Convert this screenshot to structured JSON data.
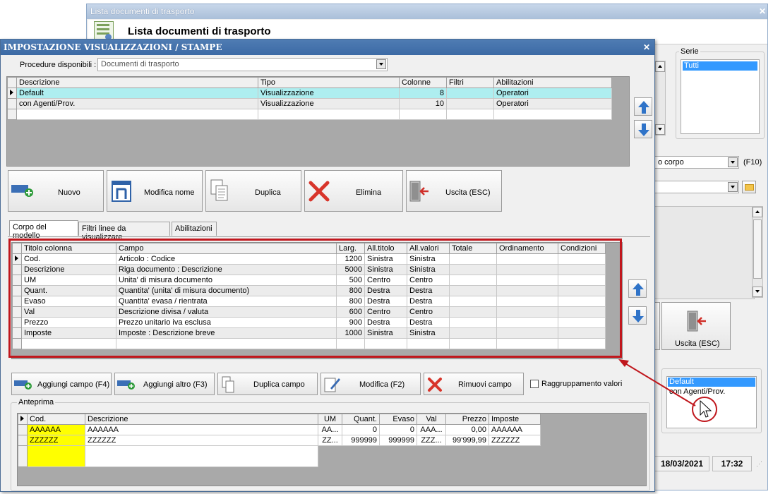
{
  "back_window": {
    "title": "Lista documenti di trasporto",
    "header_title": "Lista documenti di trasporto",
    "serie_label": "Serie",
    "serie_items": [
      "Tutti"
    ],
    "combo_right_value": "o corpo",
    "combo_right_shortcut": "(F10)",
    "uscita_label": "Uscita (ESC)",
    "profile_list": [
      "Default",
      "con Agenti/Prov."
    ],
    "status_date": "18/03/2021",
    "status_time": "17:32"
  },
  "front_window": {
    "title": "IMPOSTAZIONE VISUALIZZAZIONI / STAMPE",
    "procedure_label": "Procedure disponibili :",
    "procedure_value": "Documenti di trasporto",
    "views_grid": {
      "headers": [
        "Descrizione",
        "Tipo",
        "Colonne",
        "Filtri",
        "Abilitazioni"
      ],
      "rows": [
        [
          "Default",
          "Visualizzazione",
          "8",
          "",
          "Operatori"
        ],
        [
          "con Agenti/Prov.",
          "Visualizzazione",
          "10",
          "",
          "Operatori"
        ]
      ]
    },
    "buttons": {
      "nuovo": "Nuovo",
      "modifica_nome": "Modifica nome",
      "duplica": "Duplica",
      "elimina": "Elimina",
      "uscita": "Uscita (ESC)"
    },
    "tabs": [
      "Corpo del modello",
      "Filtri linee da visualizzare",
      "Abilitazioni"
    ],
    "columns_grid": {
      "headers": [
        "Titolo colonna",
        "Campo",
        "Larg.",
        "All.titolo",
        "All.valori",
        "Totale",
        "Ordinamento",
        "Condizioni"
      ],
      "rows": [
        [
          "Cod.",
          "Articolo : Codice",
          "1200",
          "Sinistra",
          "Sinistra",
          "",
          "",
          ""
        ],
        [
          "Descrizione",
          "Riga documento : Descrizione",
          "5000",
          "Sinistra",
          "Sinistra",
          "",
          "",
          ""
        ],
        [
          "UM",
          "Unita' di misura documento",
          "500",
          "Centro",
          "Centro",
          "",
          "",
          ""
        ],
        [
          "Quant.",
          "Quantita' (unita' di misura documento)",
          "800",
          "Destra",
          "Destra",
          "",
          "",
          ""
        ],
        [
          "Evaso",
          "Quantita' evasa / rientrata",
          "800",
          "Destra",
          "Destra",
          "",
          "",
          ""
        ],
        [
          "Val",
          "Descrizione divisa / valuta",
          "600",
          "Centro",
          "Centro",
          "",
          "",
          ""
        ],
        [
          "Prezzo",
          "Prezzo unitario iva esclusa",
          "900",
          "Destra",
          "Destra",
          "",
          "",
          ""
        ],
        [
          "Imposte",
          "Imposte : Descrizione breve",
          "1000",
          "Sinistra",
          "Sinistra",
          "",
          "",
          ""
        ]
      ]
    },
    "field_buttons": {
      "aggiungi_campo": "Aggiungi campo (F4)",
      "aggiungi_altro": "Aggiungi altro (F3)",
      "duplica_campo": "Duplica campo",
      "modifica": "Modifica (F2)",
      "rimuovi_campo": "Rimuovi campo"
    },
    "raggruppamento_label": "Raggruppamento valori",
    "anteprima": {
      "label": "Anteprima",
      "headers": [
        "Cod.",
        "Descrizione",
        "UM",
        "Quant.",
        "Evaso",
        "Val",
        "Prezzo",
        "Imposte"
      ],
      "rows": [
        [
          "AAAAAA",
          "AAAAAA",
          "AA...",
          "0",
          "0",
          "AAA...",
          "0,00",
          "AAAAAA"
        ],
        [
          "ZZZZZZ",
          "ZZZZZZ",
          "ZZ...",
          "999999",
          "999999",
          "ZZZ...",
          "99'999,99",
          "ZZZZZZ"
        ]
      ]
    }
  },
  "annotation": {
    "highlight_color": "#c0171d",
    "cursor_circle_color": "#c0171d"
  }
}
